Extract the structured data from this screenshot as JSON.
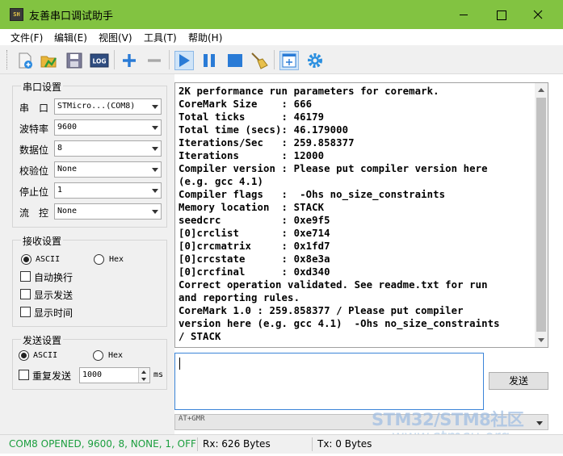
{
  "window": {
    "title": "友善串口调试助手",
    "app_icon_text": "SH"
  },
  "menu": [
    "文件(F)",
    "编辑(E)",
    "视图(V)",
    "工具(T)",
    "帮助(H)"
  ],
  "toolbar": {
    "icons": [
      "new-file-icon",
      "open-folder-icon",
      "save-icon",
      "log-icon",
      "add-icon",
      "remove-icon",
      "play-icon",
      "pause-icon",
      "stop-icon",
      "clear-broom-icon",
      "new-window-icon",
      "settings-gear-icon"
    ],
    "log_label": "LOG"
  },
  "serial": {
    "title": "串口设置",
    "port_label": "串　口",
    "port_value": "STMicro...(COM8)",
    "baud_label": "波特率",
    "baud_value": "9600",
    "databits_label": "数据位",
    "databits_value": "8",
    "parity_label": "校验位",
    "parity_value": "None",
    "stopbits_label": "停止位",
    "stopbits_value": "1",
    "flow_label": "流　控",
    "flow_value": "None"
  },
  "receive_settings": {
    "title": "接收设置",
    "ascii": "ASCII",
    "hex": "Hex",
    "mode_selected": "ASCII",
    "auto_wrap": "自动换行",
    "show_send": "显示发送",
    "show_time": "显示时间"
  },
  "send_settings": {
    "title": "发送设置",
    "ascii": "ASCII",
    "hex": "Hex",
    "mode_selected": "ASCII",
    "repeat": "重复发送",
    "interval": "1000",
    "unit": "ms"
  },
  "receive_area": {
    "lines": [
      "2K performance run parameters for coremark.",
      "CoreMark Size    : 666",
      "Total ticks      : 46179",
      "Total time (secs): 46.179000",
      "Iterations/Sec   : 259.858377",
      "Iterations       : 12000",
      "Compiler version : Please put compiler version here",
      "(e.g. gcc 4.1)",
      "Compiler flags   :  -Ohs no_size_constraints",
      "Memory location  : STACK",
      "seedcrc          : 0xe9f5",
      "[0]crclist       : 0xe714",
      "[0]crcmatrix     : 0x1fd7",
      "[0]crcstate      : 0x8e3a",
      "[0]crcfinal      : 0xd340",
      "Correct operation validated. See readme.txt for run",
      "and reporting rules.",
      "CoreMark 1.0 : 259.858377 / Please put compiler",
      "version here (e.g. gcc 4.1)  -Ohs no_size_constraints",
      "/ STACK"
    ]
  },
  "send_area": {
    "value": "",
    "send_button": "发送",
    "history_value": "AT+GMR"
  },
  "watermark": {
    "line1": "STM32/STM8社区",
    "line2": "www.stmcu.org"
  },
  "status": {
    "connection": "COM8 OPENED, 9600, 8, NONE, 1, OFF",
    "connection_color": "#1b9e3e",
    "rx": "Rx: 626 Bytes",
    "tx": "Tx: 0 Bytes"
  },
  "colors": {
    "titlebar": "#82c341",
    "accent_blue": "#2a7bd6"
  }
}
